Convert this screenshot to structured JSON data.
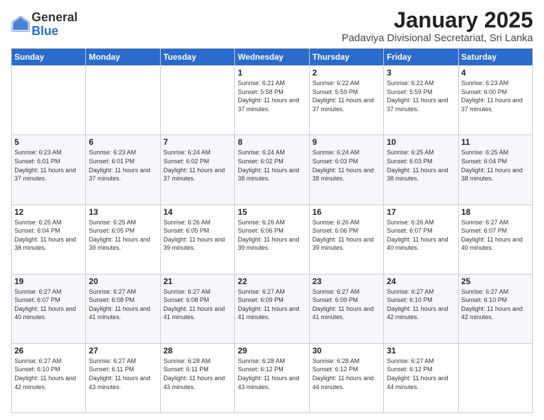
{
  "logo": {
    "general": "General",
    "blue": "Blue"
  },
  "title": "January 2025",
  "location": "Padaviya Divisional Secretariat, Sri Lanka",
  "headers": [
    "Sunday",
    "Monday",
    "Tuesday",
    "Wednesday",
    "Thursday",
    "Friday",
    "Saturday"
  ],
  "weeks": [
    [
      {
        "day": "",
        "sunrise": "",
        "sunset": "",
        "daylight": ""
      },
      {
        "day": "",
        "sunrise": "",
        "sunset": "",
        "daylight": ""
      },
      {
        "day": "",
        "sunrise": "",
        "sunset": "",
        "daylight": ""
      },
      {
        "day": "1",
        "sunrise": "Sunrise: 6:21 AM",
        "sunset": "Sunset: 5:58 PM",
        "daylight": "Daylight: 11 hours and 37 minutes."
      },
      {
        "day": "2",
        "sunrise": "Sunrise: 6:22 AM",
        "sunset": "Sunset: 5:59 PM",
        "daylight": "Daylight: 11 hours and 37 minutes."
      },
      {
        "day": "3",
        "sunrise": "Sunrise: 6:22 AM",
        "sunset": "Sunset: 5:59 PM",
        "daylight": "Daylight: 11 hours and 37 minutes."
      },
      {
        "day": "4",
        "sunrise": "Sunrise: 6:23 AM",
        "sunset": "Sunset: 6:00 PM",
        "daylight": "Daylight: 11 hours and 37 minutes."
      }
    ],
    [
      {
        "day": "5",
        "sunrise": "Sunrise: 6:23 AM",
        "sunset": "Sunset: 6:01 PM",
        "daylight": "Daylight: 11 hours and 37 minutes."
      },
      {
        "day": "6",
        "sunrise": "Sunrise: 6:23 AM",
        "sunset": "Sunset: 6:01 PM",
        "daylight": "Daylight: 11 hours and 37 minutes."
      },
      {
        "day": "7",
        "sunrise": "Sunrise: 6:24 AM",
        "sunset": "Sunset: 6:02 PM",
        "daylight": "Daylight: 11 hours and 37 minutes."
      },
      {
        "day": "8",
        "sunrise": "Sunrise: 6:24 AM",
        "sunset": "Sunset: 6:02 PM",
        "daylight": "Daylight: 11 hours and 38 minutes."
      },
      {
        "day": "9",
        "sunrise": "Sunrise: 6:24 AM",
        "sunset": "Sunset: 6:03 PM",
        "daylight": "Daylight: 11 hours and 38 minutes."
      },
      {
        "day": "10",
        "sunrise": "Sunrise: 6:25 AM",
        "sunset": "Sunset: 6:03 PM",
        "daylight": "Daylight: 11 hours and 38 minutes."
      },
      {
        "day": "11",
        "sunrise": "Sunrise: 6:25 AM",
        "sunset": "Sunset: 6:04 PM",
        "daylight": "Daylight: 11 hours and 38 minutes."
      }
    ],
    [
      {
        "day": "12",
        "sunrise": "Sunrise: 6:25 AM",
        "sunset": "Sunset: 6:04 PM",
        "daylight": "Daylight: 11 hours and 38 minutes."
      },
      {
        "day": "13",
        "sunrise": "Sunrise: 6:25 AM",
        "sunset": "Sunset: 6:05 PM",
        "daylight": "Daylight: 11 hours and 39 minutes."
      },
      {
        "day": "14",
        "sunrise": "Sunrise: 6:26 AM",
        "sunset": "Sunset: 6:05 PM",
        "daylight": "Daylight: 11 hours and 39 minutes."
      },
      {
        "day": "15",
        "sunrise": "Sunrise: 6:26 AM",
        "sunset": "Sunset: 6:06 PM",
        "daylight": "Daylight: 11 hours and 39 minutes."
      },
      {
        "day": "16",
        "sunrise": "Sunrise: 6:26 AM",
        "sunset": "Sunset: 6:06 PM",
        "daylight": "Daylight: 11 hours and 39 minutes."
      },
      {
        "day": "17",
        "sunrise": "Sunrise: 6:26 AM",
        "sunset": "Sunset: 6:07 PM",
        "daylight": "Daylight: 11 hours and 40 minutes."
      },
      {
        "day": "18",
        "sunrise": "Sunrise: 6:27 AM",
        "sunset": "Sunset: 6:07 PM",
        "daylight": "Daylight: 11 hours and 40 minutes."
      }
    ],
    [
      {
        "day": "19",
        "sunrise": "Sunrise: 6:27 AM",
        "sunset": "Sunset: 6:07 PM",
        "daylight": "Daylight: 11 hours and 40 minutes."
      },
      {
        "day": "20",
        "sunrise": "Sunrise: 6:27 AM",
        "sunset": "Sunset: 6:08 PM",
        "daylight": "Daylight: 11 hours and 41 minutes."
      },
      {
        "day": "21",
        "sunrise": "Sunrise: 6:27 AM",
        "sunset": "Sunset: 6:08 PM",
        "daylight": "Daylight: 11 hours and 41 minutes."
      },
      {
        "day": "22",
        "sunrise": "Sunrise: 6:27 AM",
        "sunset": "Sunset: 6:09 PM",
        "daylight": "Daylight: 11 hours and 41 minutes."
      },
      {
        "day": "23",
        "sunrise": "Sunrise: 6:27 AM",
        "sunset": "Sunset: 6:09 PM",
        "daylight": "Daylight: 11 hours and 41 minutes."
      },
      {
        "day": "24",
        "sunrise": "Sunrise: 6:27 AM",
        "sunset": "Sunset: 6:10 PM",
        "daylight": "Daylight: 11 hours and 42 minutes."
      },
      {
        "day": "25",
        "sunrise": "Sunrise: 6:27 AM",
        "sunset": "Sunset: 6:10 PM",
        "daylight": "Daylight: 11 hours and 42 minutes."
      }
    ],
    [
      {
        "day": "26",
        "sunrise": "Sunrise: 6:27 AM",
        "sunset": "Sunset: 6:10 PM",
        "daylight": "Daylight: 11 hours and 42 minutes."
      },
      {
        "day": "27",
        "sunrise": "Sunrise: 6:27 AM",
        "sunset": "Sunset: 6:11 PM",
        "daylight": "Daylight: 11 hours and 43 minutes."
      },
      {
        "day": "28",
        "sunrise": "Sunrise: 6:28 AM",
        "sunset": "Sunset: 6:11 PM",
        "daylight": "Daylight: 11 hours and 43 minutes."
      },
      {
        "day": "29",
        "sunrise": "Sunrise: 6:28 AM",
        "sunset": "Sunset: 6:12 PM",
        "daylight": "Daylight: 11 hours and 43 minutes."
      },
      {
        "day": "30",
        "sunrise": "Sunrise: 6:28 AM",
        "sunset": "Sunset: 6:12 PM",
        "daylight": "Daylight: 11 hours and 44 minutes."
      },
      {
        "day": "31",
        "sunrise": "Sunrise: 6:27 AM",
        "sunset": "Sunset: 6:12 PM",
        "daylight": "Daylight: 11 hours and 44 minutes."
      },
      {
        "day": "",
        "sunrise": "",
        "sunset": "",
        "daylight": ""
      }
    ]
  ]
}
